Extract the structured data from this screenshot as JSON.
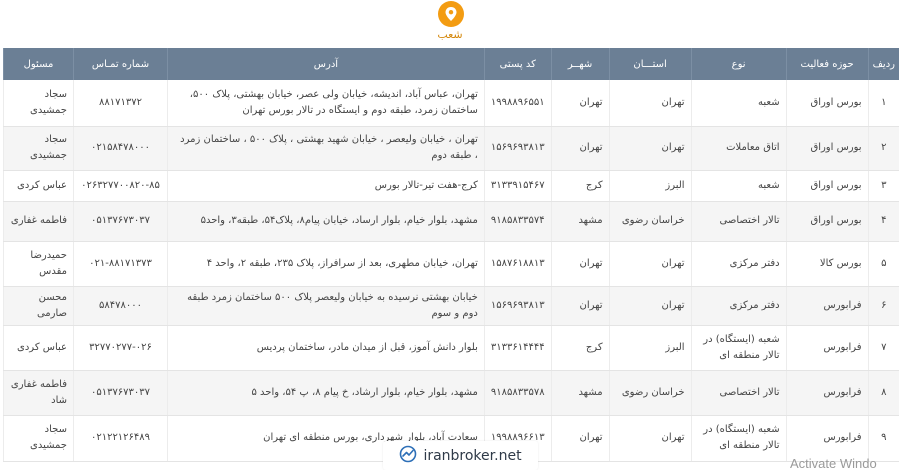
{
  "section": {
    "title": "شعب",
    "icon": "location-pin-icon",
    "accent": "#f39c12"
  },
  "table": {
    "headers": [
      "ردیف",
      "حوزه فعالیت",
      "نوع",
      "استـــان",
      "شهــر",
      "کد پستی",
      "آدرس",
      "شماره تمـاس",
      "مسئول"
    ],
    "header_bg": "#6b7f95",
    "rows": [
      {
        "num": "۱",
        "field": "بورس اوراق",
        "type": "شعبه",
        "province": "تهران",
        "city": "تهران",
        "postal": "۱۹۹۸۸۹۶۵۵۱",
        "address": "تهران، عباس آباد، اندیشه، خیابان ولی عصر، خیابان بهشتی، پلاک ۵۰۰، ساختمان زمرد، طبقه دوم و ایستگاه در تالار بورس تهران",
        "phone": "۸۸۱۷۱۳۷۲",
        "responsible": "سجاد جمشیدی"
      },
      {
        "num": "۲",
        "field": "بورس اوراق",
        "type": "اتاق معاملات",
        "province": "تهران",
        "city": "تهران",
        "postal": "۱۵۶۹۶۹۳۸۱۳",
        "address": "تهران ، خیابان ولیعصر ، خیابان شهید بهشتی ، پلاک ۵۰۰ ، ساختمان زمرد ، طبقه دوم",
        "phone": "۰۲۱۵۸۴۷۸۰۰۰",
        "responsible": "سجاد جمشیدی"
      },
      {
        "num": "۳",
        "field": "بورس اوراق",
        "type": "شعبه",
        "province": "البرز",
        "city": "کرج",
        "postal": "۳۱۳۳۹۱۵۴۶۷",
        "address": "کرج-هفت تیر-تالار بورس",
        "phone": "۰۲۶۳۲۷۷۰۰۸۲۰-۸۵",
        "responsible": "عباس کردی"
      },
      {
        "num": "۴",
        "field": "بورس اوراق",
        "type": "تالار اختصاصی",
        "province": "خراسان رضوی",
        "city": "مشهد",
        "postal": "۹۱۸۵۸۳۳۵۷۴",
        "address": "مشهد، بلوار خیام، بلوار ارساد، خیابان پیام۸، پلاک۵۴، طبقه۳، واحد۵",
        "phone": "۰۵۱۳۷۶۷۳۰۳۷",
        "responsible": "فاطمه غفاری"
      },
      {
        "num": "۵",
        "field": "بورس کالا",
        "type": "دفتر مرکزی",
        "province": "تهران",
        "city": "تهران",
        "postal": "۱۵۸۷۶۱۸۸۱۳",
        "address": "تهران، خیابان مطهری، بعد از سرافراز، پلاک ۲۳۵، طبقه ۲، واحد ۴",
        "phone": "۰۲۱-۸۸۱۷۱۳۷۳",
        "responsible": "حمیدرضا مقدس"
      },
      {
        "num": "۶",
        "field": "فرابورس",
        "type": "دفتر مرکزی",
        "province": "تهران",
        "city": "تهران",
        "postal": "۱۵۶۹۶۹۳۸۱۳",
        "address": "خیابان بهشتی نرسیده به خیابان ولیعصر پلاک ۵۰۰ ساختمان زمرد طبقه دوم و سوم",
        "phone": "۵۸۴۷۸۰۰۰",
        "responsible": "محسن صارمی"
      },
      {
        "num": "۷",
        "field": "فرابورس",
        "type": "شعبه (ایستگاه) در تالار منطقه ای",
        "province": "البرز",
        "city": "کرج",
        "postal": "۳۱۳۳۶۱۴۴۴۴",
        "address": "بلوار دانش آموز، قبل از میدان مادر، ساختمان پردیس",
        "phone": "۳۲۷۷۰۲۷۷-۰۲۶",
        "responsible": "عباس کردی"
      },
      {
        "num": "۸",
        "field": "فرابورس",
        "type": "تالار اختصاصی",
        "province": "خراسان رضوی",
        "city": "مشهد",
        "postal": "۹۱۸۵۸۳۳۵۷۸",
        "address": "مشهد، بلوار خیام، بلوار ارشاد، خ پیام ۸، پ ۵۴، واحد ۵",
        "phone": "۰۵۱۳۷۶۷۳۰۳۷",
        "responsible": "فاطمه غفاری شاد"
      },
      {
        "num": "۹",
        "field": "فرابورس",
        "type": "شعبه (ایستگاه) در تالار منطقه ای",
        "province": "تهران",
        "city": "تهران",
        "postal": "۱۹۹۸۸۹۶۶۱۳",
        "address": "سعادت آباد، بلوار شهرداری، بورس منطقه ای تهران",
        "phone": "۰۲۱۲۲۱۲۶۴۸۹",
        "responsible": "سجاد جمشیدی"
      }
    ]
  },
  "watermark": {
    "text": "iranbroker.net",
    "icon": "iranbroker-logo-icon"
  },
  "system": {
    "activate_text": "Activate Windo"
  }
}
